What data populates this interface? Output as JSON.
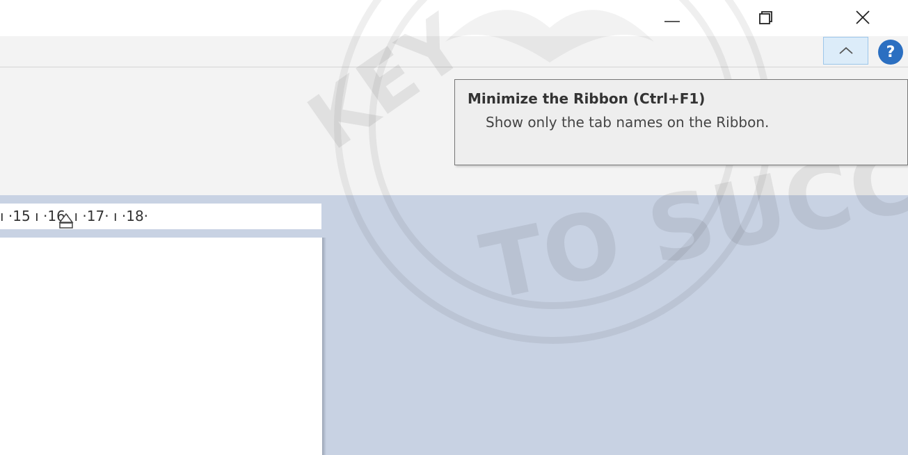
{
  "window": {
    "minimize_icon": "minimize-icon",
    "restore_icon": "restore-icon",
    "close_icon": "close-icon"
  },
  "ribbon": {
    "collapse_icon": "chevron-up-icon",
    "help_label": "?"
  },
  "tooltip": {
    "title": "Minimize the Ribbon (Ctrl+F1)",
    "description": "Show only the tab names on the Ribbon."
  },
  "ruler": {
    "text": "ı ·15 ı ·16· ı ·17· ı ·18·",
    "marker_icon": "indent-marker-icon"
  },
  "watermark": {
    "text_upper": "KEY",
    "text_lower": "TO SUCCE"
  },
  "colors": {
    "accent": "#2b6fc1",
    "workspace": "#c8d2e3",
    "ribbon": "#f3f3f3"
  }
}
